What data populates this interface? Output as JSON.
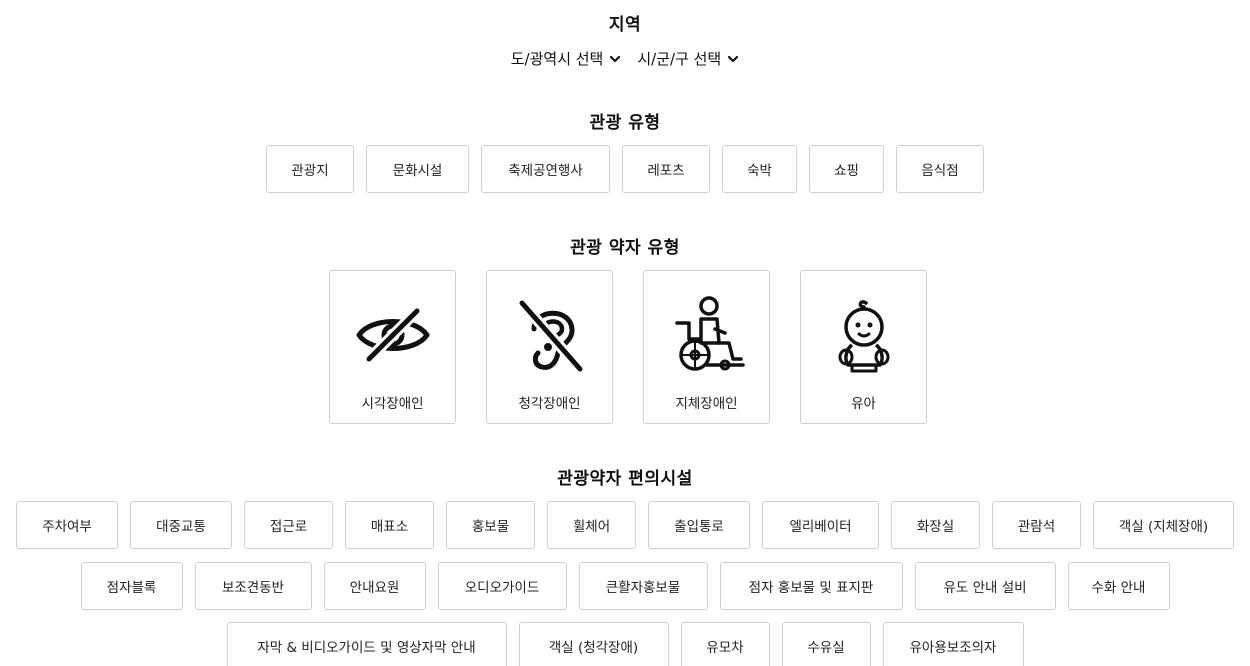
{
  "region": {
    "title": "지역",
    "province_select": "도/광역시 선택",
    "city_select": "시/군/구 선택"
  },
  "tour_type": {
    "title": "관광 유형",
    "items": [
      "관광지",
      "문화시설",
      "축제공연행사",
      "레포츠",
      "숙박",
      "쇼핑",
      "음식점"
    ]
  },
  "vulnerable_type": {
    "title": "관광 약자 유형",
    "items": [
      {
        "label": "시각장애인",
        "icon": "eye-slash-icon"
      },
      {
        "label": "청각장애인",
        "icon": "hearing-impaired-icon"
      },
      {
        "label": "지체장애인",
        "icon": "wheelchair-icon"
      },
      {
        "label": "유아",
        "icon": "baby-icon"
      }
    ]
  },
  "facilities": {
    "title": "관광약자 편의시설",
    "row1": [
      "주차여부",
      "대중교통",
      "접근로",
      "매표소",
      "홍보물",
      "휠체어",
      "출입통로",
      "엘리베이터",
      "화장실",
      "관람석",
      "객실 (지체장애)"
    ],
    "row2": [
      "점자블록",
      "보조견동반",
      "안내요원",
      "오디오가이드",
      "큰활자홍보물",
      "점자 홍보물 및 표지판",
      "유도 안내 설비",
      "수화 안내"
    ],
    "row3": [
      "자막 & 비디오가이드 및 영상자막 안내",
      "객실 (청각장애)",
      "유모차",
      "수유실",
      "유아용보조의자"
    ]
  }
}
